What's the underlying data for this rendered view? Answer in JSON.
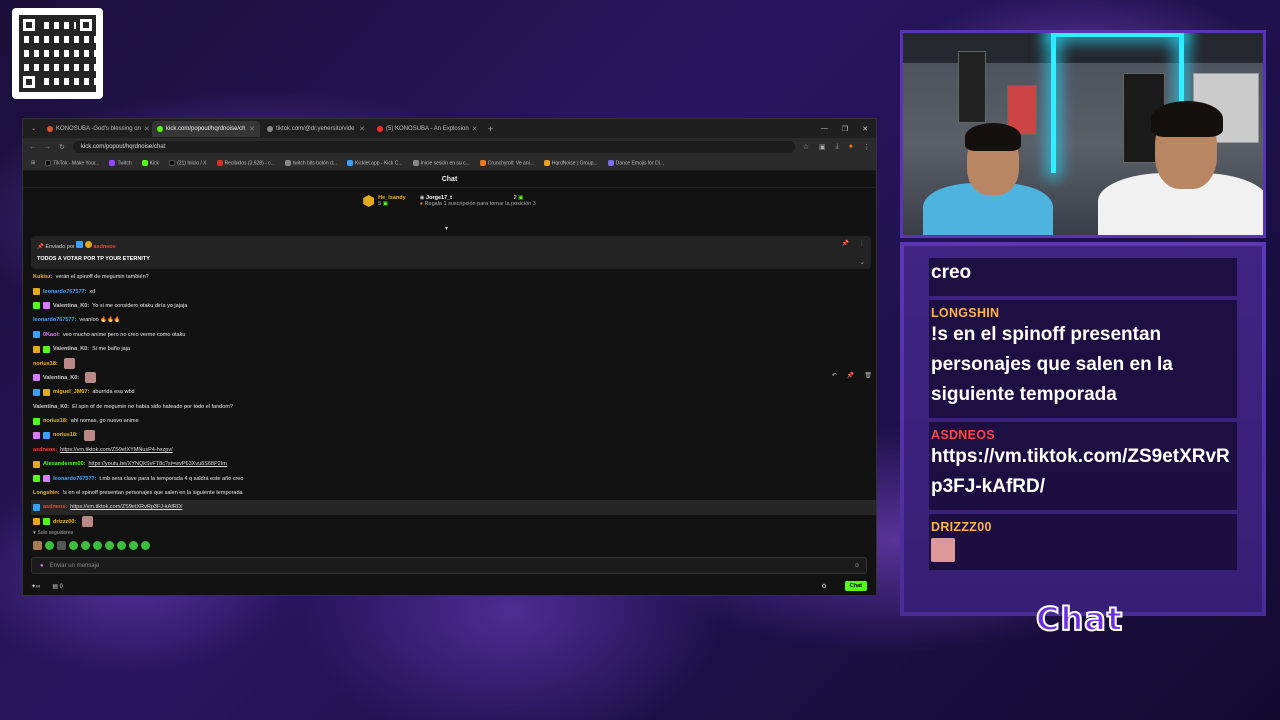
{
  "browser": {
    "tabs": [
      {
        "label": "KONOSUBA -God's blessing on",
        "color": "#e0522c",
        "active": false
      },
      {
        "label": "kick.com/popout/hqrdnoise/ch",
        "color": "#53fc18",
        "active": true
      },
      {
        "label": "tiktok.com/@dr.yenersito/vide",
        "color": "#888888",
        "active": false
      },
      {
        "label": "(5) KONOSUBA - An Explosion",
        "color": "#ff2a2a",
        "active": false
      }
    ],
    "url": "kick.com/popout/hqrdnoise/chat",
    "bookmarks": [
      {
        "label": "TikTok - Make Your...",
        "color": "#000000"
      },
      {
        "label": "Twitch",
        "color": "#9146ff"
      },
      {
        "label": "Kick",
        "color": "#53fc18"
      },
      {
        "label": "(21) Inicio / X",
        "color": "#000000"
      },
      {
        "label": "Recibidos (3,628) - c...",
        "color": "#d93025"
      },
      {
        "label": "twitch bits botón d...",
        "color": "#888888"
      },
      {
        "label": "Kicklet.app - Kick C...",
        "color": "#3aa0ff"
      },
      {
        "label": "Inicie sesión en su c...",
        "color": "#888888"
      },
      {
        "label": "Crunchyroll: Ve ani...",
        "color": "#f47521"
      },
      {
        "label": "HqrdNoise | Group...",
        "color": "#e8a020"
      },
      {
        "label": "Dance Emojis for Di...",
        "color": "#7a6cf0"
      }
    ]
  },
  "chat": {
    "title": "Chat",
    "leaderboard": {
      "first": {
        "name": "He_isandy",
        "count": "5"
      },
      "second": {
        "name": "Jorge17_t",
        "count": "2",
        "subtitle": "Regala 1 suscripción para tomar la posición 3"
      }
    },
    "pinned": {
      "by_label": "Enviado por",
      "by_user": "asdneos",
      "message": "TODOS A VOTAR POR TP YOUR ETERNITY"
    },
    "messages": [
      {
        "user": "Kukisz:",
        "color": "#f2b81c",
        "text": "verán el spinoff de megumin también?"
      },
      {
        "user": "leonardo767577:",
        "color": "#4aa3ff",
        "text": "xd"
      },
      {
        "user": "Valentina_K0:",
        "color": "#cfcfcf",
        "text": "Yo si me considero otaku diría yo jajaja"
      },
      {
        "user": "leonardo767577:",
        "color": "#4aa3ff",
        "text": "veanloo 🔥🔥🔥"
      },
      {
        "user": "0Kaol:",
        "color": "#d87bff",
        "text": "veo mucho anime pero no creo verme como otaku"
      },
      {
        "user": "Valentina_K0:",
        "color": "#cfcfcf",
        "text": "Si me baño jaja"
      },
      {
        "user": "norius18:",
        "color": "#f2b81c",
        "text": ""
      },
      {
        "user": "Valentina_K0:",
        "color": "#cfcfcf",
        "text": ""
      },
      {
        "user": "miguel_JM07:",
        "color": "#f2b81c",
        "text": "aburrida esa wbd"
      },
      {
        "user": "Valentina_K0:",
        "color": "#cfcfcf",
        "text": "El spin of de megumin no había sido hateado por todo el fandom?"
      },
      {
        "user": "norius18:",
        "color": "#f2b81c",
        "text": "ahí nomas, go nuevo anime"
      },
      {
        "user": "norius18:",
        "color": "#f2b81c",
        "text": ""
      },
      {
        "user": "asdneos:",
        "color": "#ff3b3b",
        "text": "https://vm.tiktok.com/ZS9etXYMNusP4-hxzpv/"
      },
      {
        "user": "Alexandersm00:",
        "color": "#53fc18",
        "text": "https://youtu.be/XYNQkSvFT8c?si=wvP63Xvu8S68P2Im"
      },
      {
        "user": "leonardo767577:",
        "color": "#4aa3ff",
        "text": "t.mb sera clave para la temporada 4 q saldrá este año creo"
      },
      {
        "user": "Longshin:",
        "color": "#f2b81c",
        "text": "!s en el spinoff presentan personajes que salen en la siguiente temporada"
      },
      {
        "user": "asdneos:",
        "color": "#ff3b3b",
        "text": "https://vm.tiktok.com/ZS9etXRvRp3FJ-kAfRD/"
      },
      {
        "user": "drizzz00:",
        "color": "#f2b81c",
        "text": ""
      }
    ],
    "followers_only": "Solo seguidores",
    "input_placeholder": "Enviar un mensaje",
    "viewer_count": "0",
    "send_label": "Chat"
  },
  "overlay": {
    "messages": [
      {
        "user": "",
        "text": "creo"
      },
      {
        "user": "LONGSHIN",
        "text": "!s en el spinoff presentan personajes que salen en la siguiente temporada"
      },
      {
        "user": "ASDNEOS",
        "text": "https://vm.tiktok.com/ZS9etXRvRp3FJ-kAfRD/"
      },
      {
        "user": "DRIZZZ00",
        "text": ""
      }
    ],
    "label": "Chat"
  }
}
